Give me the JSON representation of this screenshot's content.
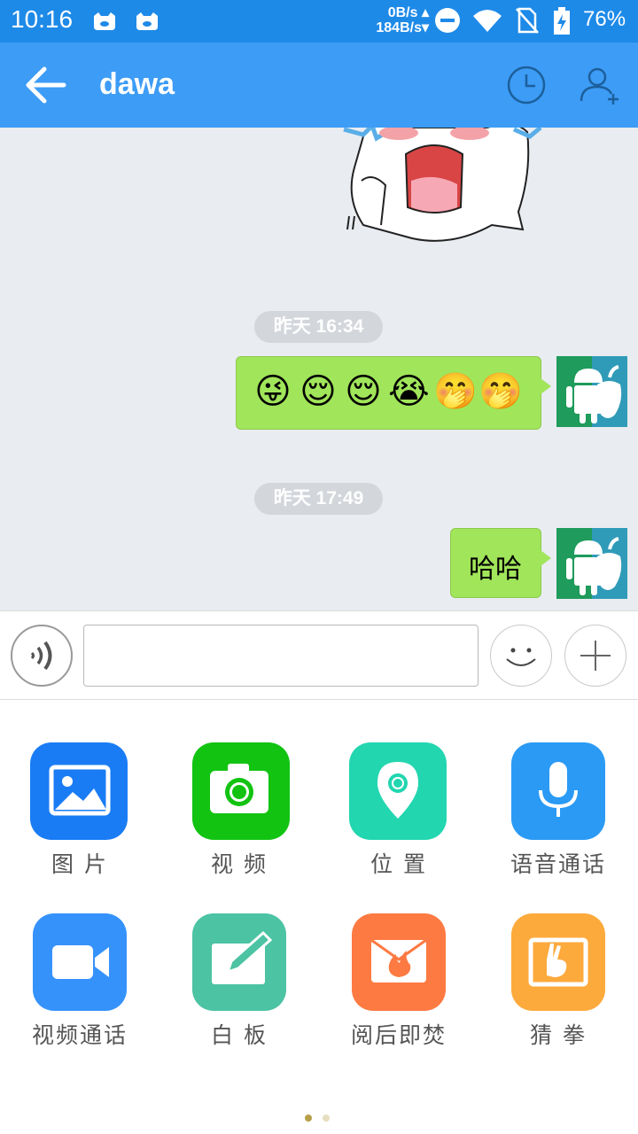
{
  "status_bar": {
    "time": "10:16",
    "net_up": "0B/s",
    "net_down": "184B/s",
    "battery": "76%"
  },
  "app_bar": {
    "title": "dawa"
  },
  "chat": {
    "messages": [
      {
        "timestamp": "昨天 16:34",
        "emojis": [
          "😜",
          "😌",
          "😌",
          "😭",
          "🤭",
          "🤭"
        ]
      },
      {
        "timestamp": "昨天 17:49",
        "text": "哈哈"
      }
    ]
  },
  "input": {
    "value": "",
    "placeholder": ""
  },
  "panel": {
    "items": [
      {
        "label": "图 片",
        "icon": "image-icon",
        "color": "#1a7cf5"
      },
      {
        "label": "视 频",
        "icon": "camera-icon",
        "color": "#12c312"
      },
      {
        "label": "位 置",
        "icon": "location-icon",
        "color": "#22d6b0"
      },
      {
        "label": "语音通话",
        "icon": "microphone-icon",
        "color": "#2a9af5"
      },
      {
        "label": "视频通话",
        "icon": "video-call-icon",
        "color": "#3592fb"
      },
      {
        "label": "白 板",
        "icon": "whiteboard-icon",
        "color": "#4cc3a3"
      },
      {
        "label": "阅后即焚",
        "icon": "burn-after-reading-icon",
        "color": "#fd7a42"
      },
      {
        "label": "猜 拳",
        "icon": "rock-paper-scissors-icon",
        "color": "#fdaa3c"
      }
    ],
    "page_indicator": {
      "active_color": "#b8a04a",
      "inactive_color": "#e6dfbf"
    }
  }
}
